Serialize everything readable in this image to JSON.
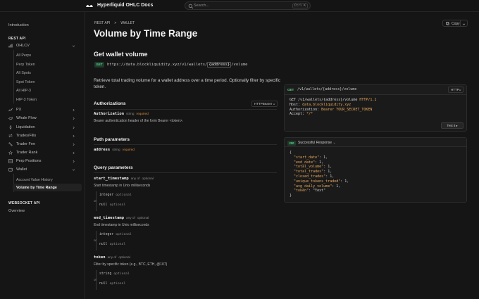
{
  "header": {
    "brand": "Hyperliquid OHLC Docs",
    "search_placeholder": "Search...",
    "search_shortcut": "Ctrl K"
  },
  "sidebar": {
    "introduction": "Introduction",
    "rest_api": "REST API",
    "ohlcv": "OHLCV",
    "ohlcv_items": [
      "All Perps",
      "Perp Token",
      "All Spots",
      "Spot Token",
      "All HIP-3",
      "HIP-3 Token"
    ],
    "groups": [
      "PX",
      "Whale Flow",
      "Liquidation",
      "Trades/Fills",
      "Trader Fee",
      "Trader Rank",
      "Perp Positions",
      "Wallet"
    ],
    "wallet_items": [
      "Account Value History",
      "Volume by Time Range"
    ],
    "websocket_api": "WEBSOCKET API",
    "overview": "Overview"
  },
  "breadcrumb": {
    "section": "REST API",
    "sep": ">",
    "page": "WALLET"
  },
  "copy_label": "Copy",
  "page_title": "Volume by Time Range",
  "endpoint": {
    "title": "Get wallet volume",
    "method": "GET",
    "url_prefix": "https://data.blockliquidity.xyz/v1/wallets/",
    "url_param": "{address}",
    "url_suffix": "/volume",
    "description": "Retrieve total trading volume for a wallet address over a time period. Optionally filter by specific token."
  },
  "authorizations": {
    "title": "Authorizations",
    "selector": "HTTPBearer",
    "param_name": "Authorization",
    "param_type": "string",
    "param_req": "required",
    "param_desc": "Bearer authentication header of the form Bearer <token>."
  },
  "path_params": {
    "title": "Path parameters",
    "name": "address",
    "type": "string",
    "req": "required"
  },
  "query_params": {
    "title": "Query parameters",
    "items": [
      {
        "name": "start_timestamp",
        "type": "any of",
        "opt": "optional",
        "desc": "Start timestamp in Unix milliseconds",
        "union": [
          {
            "t": "integer",
            "o": "optional"
          },
          {
            "t": "null",
            "o": "optional"
          }
        ]
      },
      {
        "name": "end_timestamp",
        "type": "any of",
        "opt": "optional",
        "desc": "End timestamp in Unix milliseconds",
        "union": [
          {
            "t": "integer",
            "o": "optional"
          },
          {
            "t": "null",
            "o": "optional"
          }
        ]
      },
      {
        "name": "token",
        "type": "any of",
        "opt": "optional",
        "desc": "Filter by specific token (e.g., BTC, ETH, @107)",
        "union": [
          {
            "t": "string",
            "o": "optional"
          },
          {
            "t": "null",
            "o": "optional"
          }
        ]
      }
    ],
    "or_label": "or"
  },
  "request_panel": {
    "method": "GET",
    "path": "/v1/wallets/{address}/volume",
    "lang": "HTTP",
    "line1_method": "GET ",
    "line1_path": "/v1/wallets/{address}/volume",
    "line1_proto": " HTTP/1.1",
    "line2_key": "Host: ",
    "line2_val": "data.blockliquidity.xyz",
    "line3_key": "Authorization: ",
    "line3_val": "Bearer YOUR_SECRET_TOKEN",
    "line4_key": "Accept: ",
    "line4_val": "*/*",
    "test_label": "Test it"
  },
  "response_panel": {
    "status": "200",
    "label": "Successful Response",
    "open": "{",
    "lines": [
      {
        "k": "\"start_date\"",
        "v": ": 1,"
      },
      {
        "k": "\"end_date\"",
        "v": ": 1,"
      },
      {
        "k": "\"total_volume\"",
        "v": ": 1,"
      },
      {
        "k": "\"total_trades\"",
        "v": ": 1,"
      },
      {
        "k": "\"closed_trades\"",
        "v": ": 1,"
      },
      {
        "k": "\"unique_tokens_traded\"",
        "v": ": 1,"
      },
      {
        "k": "\"avg_daily_volume\"",
        "v": ": 1,"
      },
      {
        "k": "\"token\"",
        "v": ": \"text\""
      }
    ],
    "close": "}"
  }
}
